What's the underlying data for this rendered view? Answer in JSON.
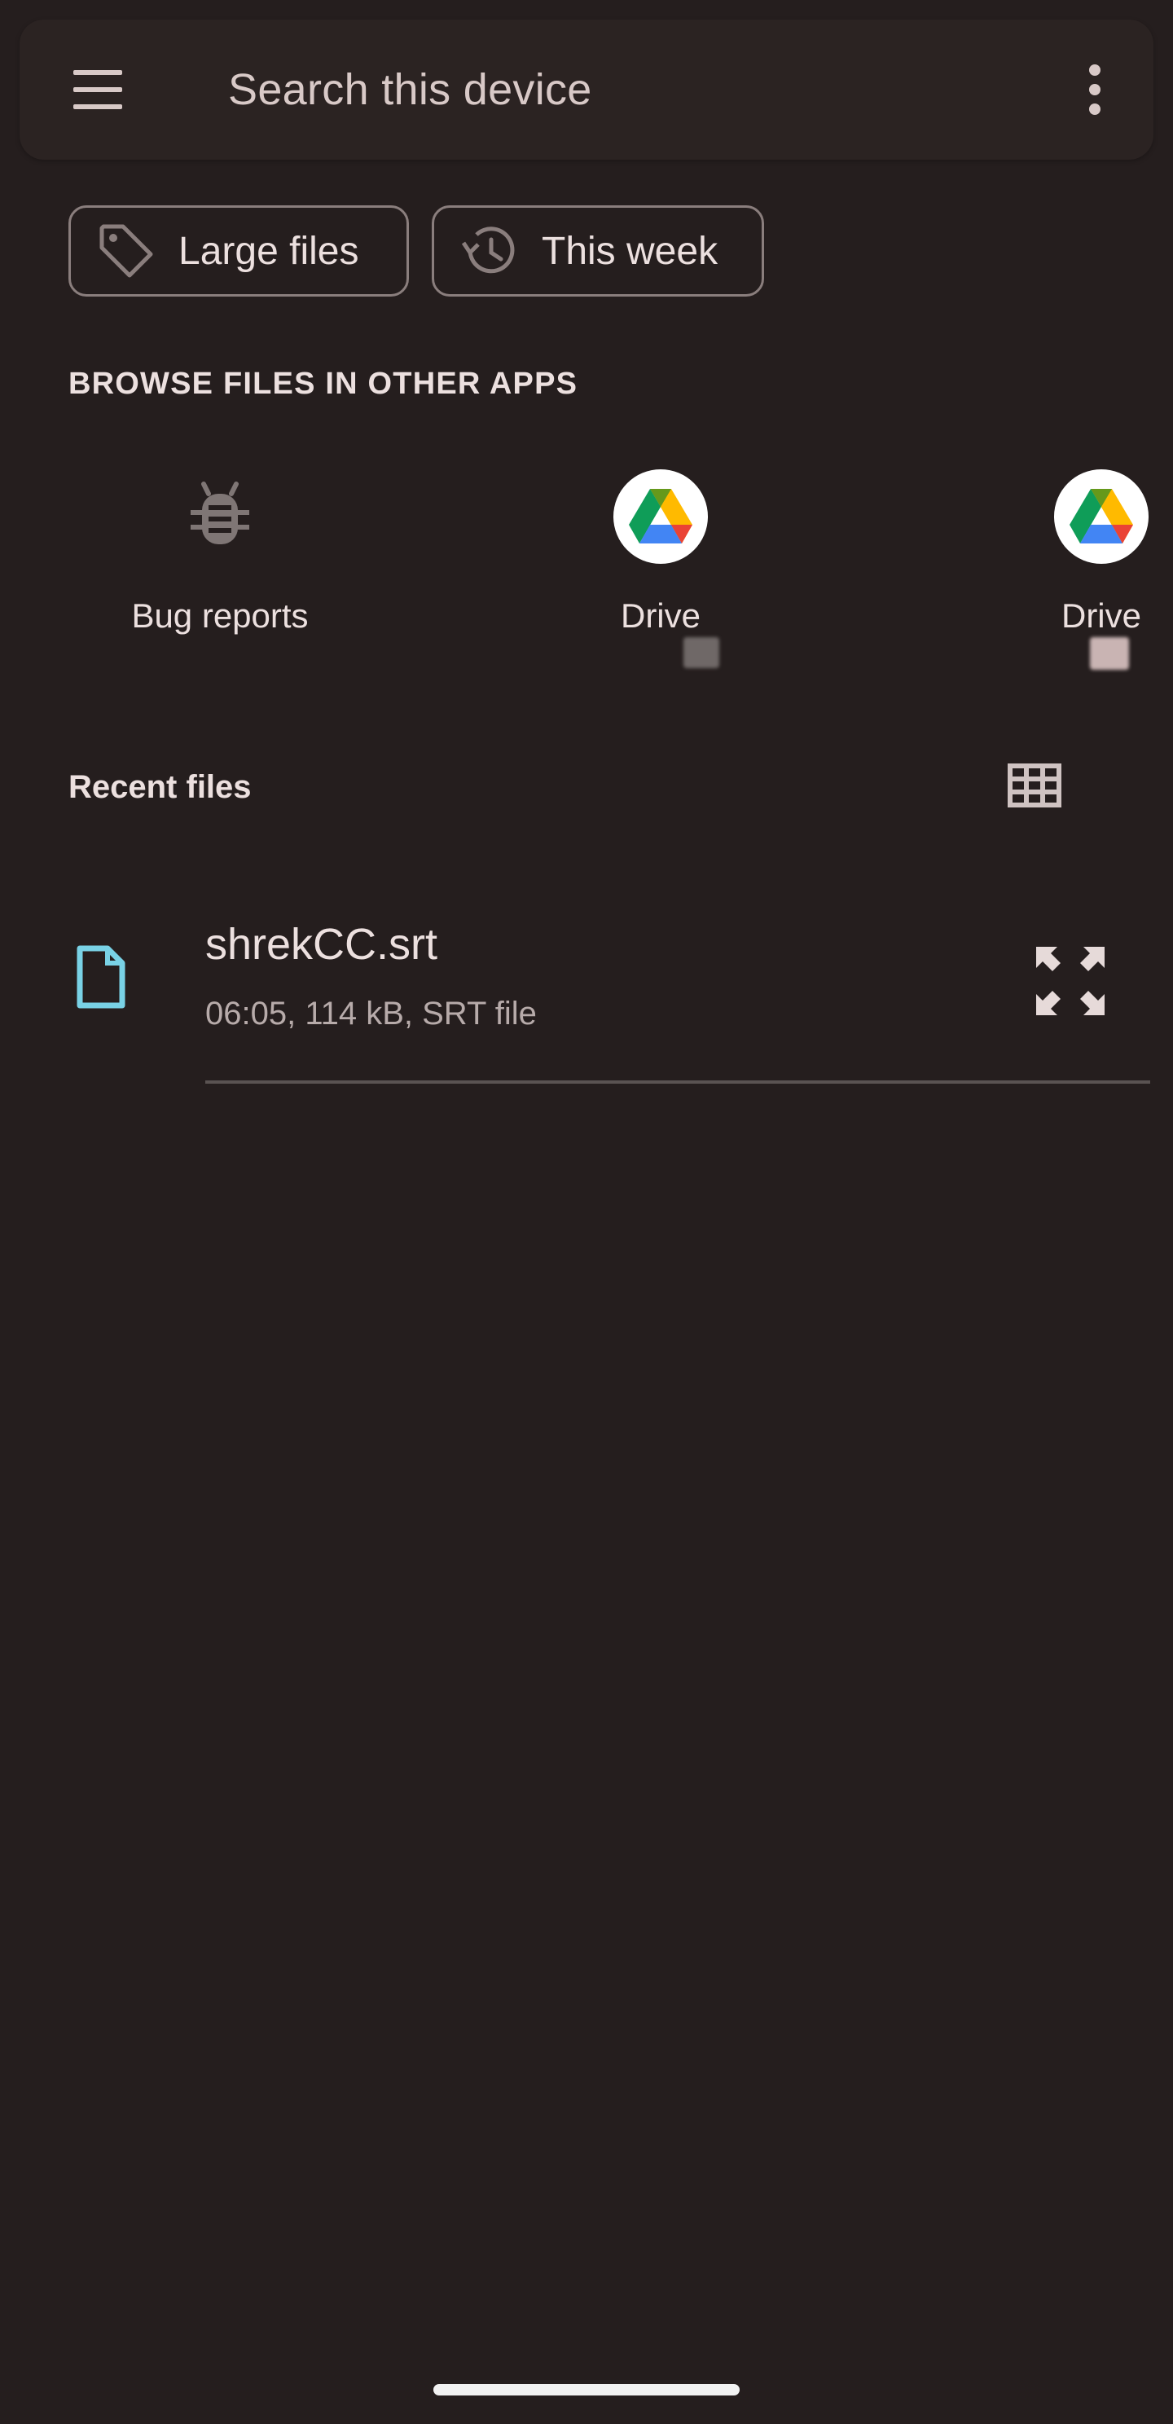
{
  "search": {
    "placeholder": "Search this device"
  },
  "chips": [
    {
      "label": "Large files",
      "icon": "tag-icon"
    },
    {
      "label": "This week",
      "icon": "history-icon"
    }
  ],
  "browse_section": {
    "title": "BROWSE FILES IN OTHER APPS"
  },
  "apps": [
    {
      "label": "Bug reports",
      "icon": "bug-icon"
    },
    {
      "label": "Drive",
      "icon": "google-drive-icon"
    },
    {
      "label": "Drive",
      "icon": "google-drive-icon"
    }
  ],
  "recent": {
    "title": "Recent files",
    "view_toggle_icon": "grid-view-icon",
    "files": [
      {
        "name": "shrekCC.srt",
        "meta": "06:05, 114 kB, SRT file",
        "icon": "file-icon"
      }
    ]
  },
  "colors": {
    "background": "#251e1e",
    "search_bar": "#2b2322",
    "file_icon": "#79d2e6",
    "text": "#ece0df",
    "muted_text": "#b7abaa"
  }
}
